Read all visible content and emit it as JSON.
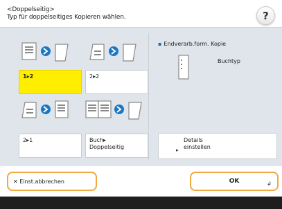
{
  "header": {
    "title": "<Doppelseitig>",
    "subtitle": "Typ für doppelseitiges Kopieren wählen.",
    "help_glyph": "?"
  },
  "modes": [
    {
      "label_line1": "1▸2",
      "label_line2": "",
      "selected": true
    },
    {
      "label_line1": "2▸2",
      "label_line2": "",
      "selected": false
    },
    {
      "label_line1": "2▸1",
      "label_line2": "",
      "selected": false
    },
    {
      "label_line1": "Buch▸",
      "label_line2": "Doppelseitig",
      "selected": false
    }
  ],
  "finish": {
    "label": "Endverarb.form. Kopie",
    "value": "Buchtyp"
  },
  "details": {
    "line1": "Details",
    "line2": "einstellen",
    "mark": "▸"
  },
  "footer": {
    "cancel_label": "✕ Einst.abbrechen",
    "ok_label": "OK",
    "ok_corner": "↲"
  },
  "colors": {
    "selected": "#ffee00",
    "accent_border": "#f0a840",
    "panel": "#dfe5ea",
    "bottom_bar": "#1e1e1e"
  }
}
